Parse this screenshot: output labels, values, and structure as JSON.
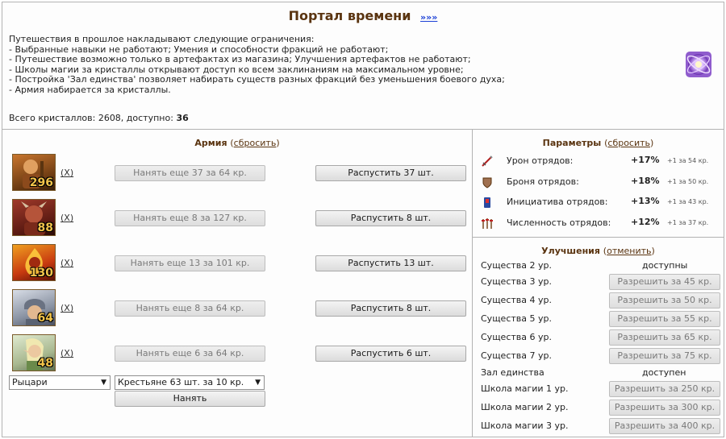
{
  "header": {
    "title": "Портал времени",
    "title_link": "»»»",
    "intro_lines": [
      "Путешествия в прошлое накладывают следующие ограничения:",
      "- Выбранные навыки не работают; Умения и способности фракций не работают;",
      "- Путешествие возможно только в артефактах из магазина; Улучшения артефактов не работают;",
      "- Школы магии за кристаллы открывают доступ ко всем заклинаниям на максимальном уровне;",
      "- Постройка 'Зал единства' позволяет набирать существ разных фракций без уменьшения боевого духа;",
      "- Армия набирается за кристаллы."
    ],
    "crystals_label": "Всего кристаллов: 2608, доступно:",
    "crystals_available": "36"
  },
  "army": {
    "title": "Армия",
    "open_paren": "(",
    "reset_label": "сбросить",
    "close_paren": ")",
    "remove_label": "(X)",
    "units": [
      {
        "count": "296",
        "hire": "Нанять еще 37 за 64 кр.",
        "dismiss": "Распустить 37 шт.",
        "icon": "peasant-icon"
      },
      {
        "count": "88",
        "hire": "Нанять еще 8 за 127 кр.",
        "dismiss": "Распустить 8 шт.",
        "icon": "demon-icon"
      },
      {
        "count": "130",
        "hire": "Нанять еще 13 за 101 кр.",
        "dismiss": "Распустить 13 шт.",
        "icon": "fire-imp-icon"
      },
      {
        "count": "64",
        "hire": "Нанять еще 8 за 64 кр.",
        "dismiss": "Распустить 8 шт.",
        "icon": "knight-icon"
      },
      {
        "count": "48",
        "hire": "Нанять еще 6 за 64 кр.",
        "dismiss": "Распустить 6 шт.",
        "icon": "elf-icon"
      }
    ],
    "faction_select": "Рыцари",
    "unit_select": "Крестьяне 63 шт. за 10 кр.",
    "hire_button": "Нанять"
  },
  "params": {
    "title": "Параметры",
    "open_paren": "(",
    "reset_label": "сбросить",
    "close_paren": ")",
    "rows": [
      {
        "label": "Урон отрядов:",
        "value": "+17%",
        "note": "+1 за 54 кр.",
        "icon": "damage-icon"
      },
      {
        "label": "Броня отрядов:",
        "value": "+18%",
        "note": "+1 за 50 кр.",
        "icon": "armor-icon"
      },
      {
        "label": "Инициатива отрядов:",
        "value": "+13%",
        "note": "+1 за 43 кр.",
        "icon": "initiative-icon"
      },
      {
        "label": "Численность отрядов:",
        "value": "+12%",
        "note": "+1 за 37 кр.",
        "icon": "numbers-icon"
      }
    ]
  },
  "upgrades": {
    "title": "Улучшения",
    "open_paren": "(",
    "cancel_label": "отменить",
    "close_paren": ")",
    "rows": [
      {
        "label": "Существа 2 ур.",
        "status": "доступны"
      },
      {
        "label": "Существа 3 ур.",
        "button": "Разрешить за 45 кр."
      },
      {
        "label": "Существа 4 ур.",
        "button": "Разрешить за 50 кр."
      },
      {
        "label": "Существа 5 ур.",
        "button": "Разрешить за 55 кр."
      },
      {
        "label": "Существа 6 ур.",
        "button": "Разрешить за 65 кр."
      },
      {
        "label": "Существа 7 ур.",
        "button": "Разрешить за 75 кр."
      },
      {
        "label": "Зал единства",
        "status": "доступен"
      },
      {
        "label": "Школа магии 1 ур.",
        "button": "Разрешить за 250 кр."
      },
      {
        "label": "Школа магии 2 ур.",
        "button": "Разрешить за 300 кр."
      },
      {
        "label": "Школа магии 3 ур.",
        "button": "Разрешить за 400 кр."
      }
    ]
  }
}
